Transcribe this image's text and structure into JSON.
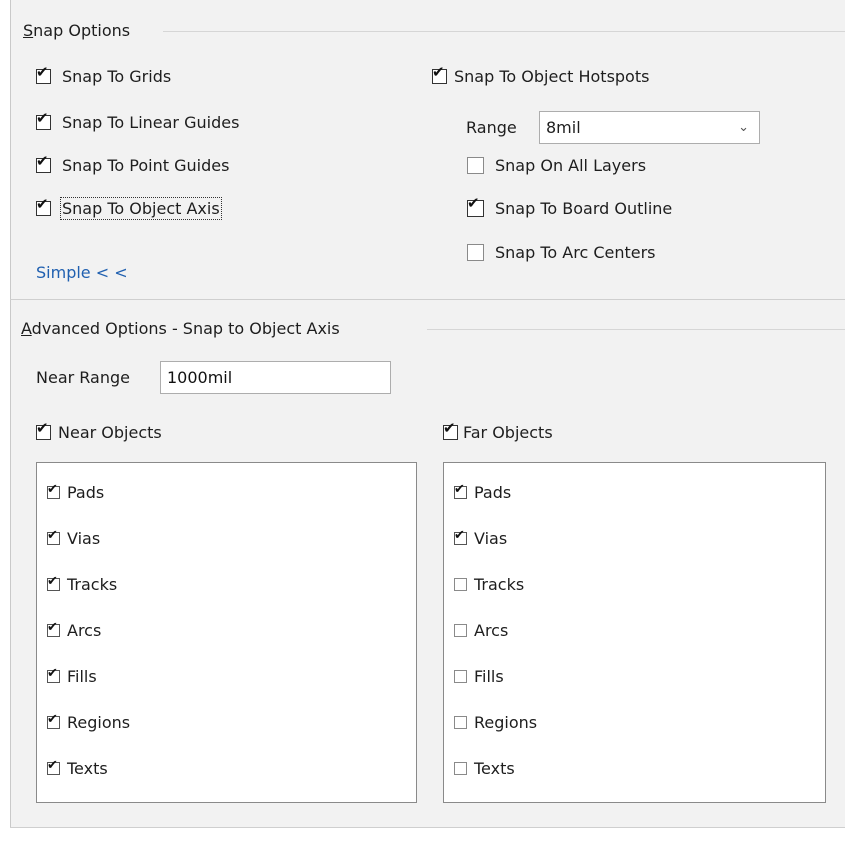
{
  "snap_options": {
    "title_mnemonic": "S",
    "title_rest": "nap Options",
    "snap_to_grids": {
      "label": "Snap To Grids",
      "checked": true
    },
    "snap_to_linear_guides": {
      "label": "Snap To Linear Guides",
      "checked": true
    },
    "snap_to_point_guides": {
      "label": "Snap To Point Guides",
      "checked": true
    },
    "snap_to_object_axis": {
      "label": "Snap To Object Axis",
      "checked": true
    },
    "simple_link": "Simple < <",
    "snap_to_object_hotspots": {
      "label": "Snap To Object Hotspots",
      "checked": true
    },
    "range_label": "Range",
    "range_value": "8mil",
    "snap_on_all_layers": {
      "label": "Snap On All Layers",
      "checked": false
    },
    "snap_to_board_outline": {
      "label": "Snap To Board Outline",
      "checked": true
    },
    "snap_to_arc_centers": {
      "label": "Snap To Arc Centers",
      "checked": false
    }
  },
  "advanced_options": {
    "title_mnemonic": "A",
    "title_rest": "dvanced Options - Snap to Object Axis",
    "near_range_label": "Near Range",
    "near_range_value": "1000mil",
    "near_objects": {
      "label": "Near Objects",
      "checked": true
    },
    "far_objects": {
      "label": "Far Objects",
      "checked": true
    },
    "near_list": [
      {
        "label": "Pads",
        "checked": true
      },
      {
        "label": "Vias",
        "checked": true
      },
      {
        "label": "Tracks",
        "checked": true
      },
      {
        "label": "Arcs",
        "checked": true
      },
      {
        "label": "Fills",
        "checked": true
      },
      {
        "label": "Regions",
        "checked": true
      },
      {
        "label": "Texts",
        "checked": true
      }
    ],
    "far_list": [
      {
        "label": "Pads",
        "checked": true
      },
      {
        "label": "Vias",
        "checked": true
      },
      {
        "label": "Tracks",
        "checked": false
      },
      {
        "label": "Arcs",
        "checked": false
      },
      {
        "label": "Fills",
        "checked": false
      },
      {
        "label": "Regions",
        "checked": false
      },
      {
        "label": "Texts",
        "checked": false
      }
    ]
  },
  "icons": {
    "check": "checkmark-icon",
    "dropdown": "chevron-down-icon"
  }
}
